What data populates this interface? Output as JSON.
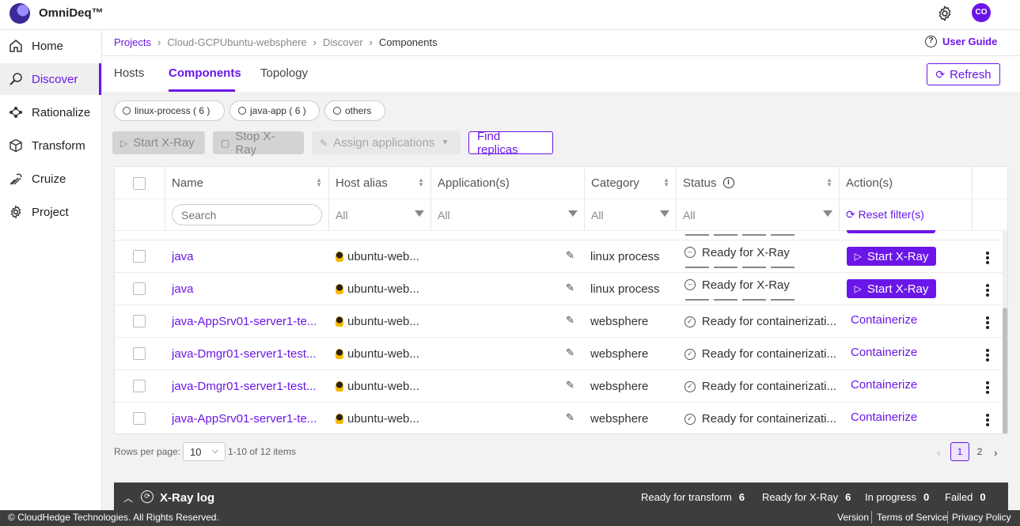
{
  "app": {
    "brand": "OmniDeq™",
    "avatar": "CO"
  },
  "sidebar": {
    "items": [
      {
        "label": "Home",
        "icon": "home-icon"
      },
      {
        "label": "Discover",
        "icon": "discover-icon"
      },
      {
        "label": "Rationalize",
        "icon": "rationalize-icon"
      },
      {
        "label": "Transform",
        "icon": "cube-icon"
      },
      {
        "label": "Cruize",
        "icon": "cruize-icon"
      },
      {
        "label": "Project",
        "icon": "gear-icon"
      }
    ],
    "active": "Discover"
  },
  "breadcrumb": [
    "Projects",
    "Cloud-GCPUbuntu-websphere",
    "Discover",
    "Components"
  ],
  "user_guide": "User Guide",
  "tabs": [
    "Hosts",
    "Components",
    "Topology"
  ],
  "active_tab": "Components",
  "refresh_label": "Refresh",
  "chips": [
    "linux-process ( 6 )",
    "java-app ( 6 )",
    "others"
  ],
  "toolbar": {
    "start_xray": "Start X-Ray",
    "stop_xray": "Stop X-Ray",
    "assign_apps": "Assign applications",
    "find_replicas": "Find replicas"
  },
  "table": {
    "columns": [
      "Name",
      "Host alias",
      "Application(s)",
      "Category",
      "Status",
      "Action(s)"
    ],
    "filters": {
      "search_placeholder": "Search",
      "host": "All",
      "application": "All",
      "category": "All",
      "status": "All",
      "reset": "Reset filter(s)"
    },
    "rows": [
      {
        "name": "java",
        "host": "ubuntu-web...",
        "category": "linux process",
        "status": "Ready for X-Ray",
        "action": "Start X-Ray"
      },
      {
        "name": "java",
        "host": "ubuntu-web...",
        "category": "linux process",
        "status": "Ready for X-Ray",
        "action": "Start X-Ray"
      },
      {
        "name": "java-AppSrv01-server1-te...",
        "host": "ubuntu-web...",
        "category": "websphere",
        "status": "Ready for containerizati...",
        "action": "Containerize"
      },
      {
        "name": "java-Dmgr01-server1-test...",
        "host": "ubuntu-web...",
        "category": "websphere",
        "status": "Ready for containerizati...",
        "action": "Containerize"
      },
      {
        "name": "java-Dmgr01-server1-test...",
        "host": "ubuntu-web...",
        "category": "websphere",
        "status": "Ready for containerizati...",
        "action": "Containerize"
      },
      {
        "name": "java-AppSrv01-server1-te...",
        "host": "ubuntu-web...",
        "category": "websphere",
        "status": "Ready for containerizati...",
        "action": "Containerize"
      }
    ]
  },
  "pagination": {
    "rows_per_page_label": "Rows per page:",
    "rows_per_page": "10",
    "items": "1-10 of 12 items",
    "pages": [
      "1",
      "2"
    ],
    "current": "1"
  },
  "xray_log": {
    "title": "X-Ray log",
    "stats": [
      {
        "label": "Ready for transform",
        "value": "6"
      },
      {
        "label": "Ready for X-Ray",
        "value": "6"
      },
      {
        "label": "In progress",
        "value": "0"
      },
      {
        "label": "Failed",
        "value": "0"
      }
    ]
  },
  "footer": {
    "copyright": "© CloudHedge Technologies. All Rights Reserved.",
    "links": [
      "Version",
      "Terms of Service",
      "Privacy Policy"
    ]
  },
  "colors": {
    "accent": "#6b16e8",
    "dark_bar": "#3d3d3d"
  }
}
